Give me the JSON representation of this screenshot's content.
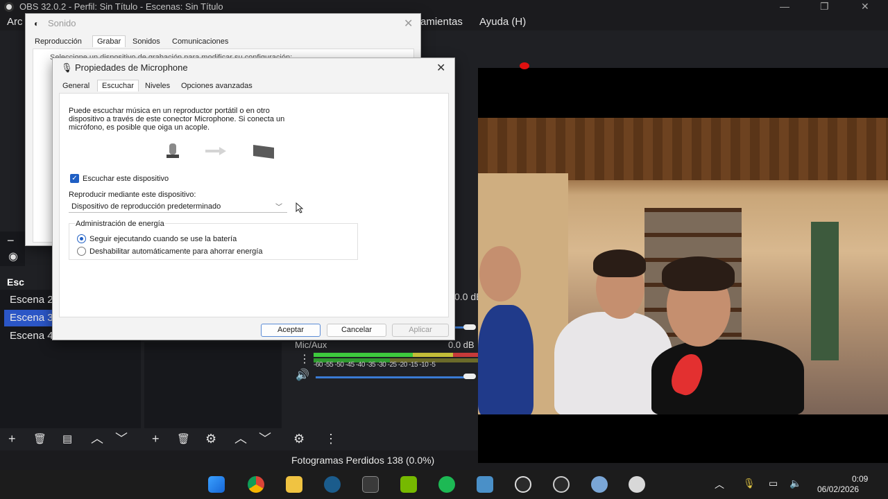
{
  "obs": {
    "title": "OBS 32.0.2 - Perfil: Sin Título - Escenas: Sin Título",
    "menu_visible": [
      "Arc",
      "amientas",
      "Ayuda (H)"
    ],
    "scenes_dock_title": "Esc",
    "scenes": [
      "Escena 2",
      "Escena 3",
      "Escena 4"
    ],
    "selected_scene": "Escena 3",
    "mixer": {
      "track_top_db": "0.0 dB",
      "track_name": "Mic/Aux",
      "track_db": "0.0 dB",
      "scale": "-60 -55 -50 -45 -40 -35 -30 -25 -20 -15 -10 -5"
    },
    "status": "Fotogramas Perdidos 138 (0.0%)"
  },
  "sound_dialog": {
    "title": "Sonido",
    "tabs": [
      "Reproducción",
      "Grabar",
      "Sonidos",
      "Comunicaciones"
    ],
    "active_tab": "Grabar",
    "hint": "Seleccione un dispositivo de grabación para modificar su configuración:"
  },
  "mic_dialog": {
    "title": "Propiedades de Microphone",
    "tabs": [
      "General",
      "Escuchar",
      "Niveles",
      "Opciones avanzadas"
    ],
    "active_tab": "Escuchar",
    "description": [
      "Puede escuchar música en un reproductor portátil o en otro",
      "dispositivo a través de este conector Microphone. Si conecta un",
      "micrófono, es posible que oiga un acople."
    ],
    "listen_checkbox": {
      "label": "Escuchar este dispositivo",
      "checked": true
    },
    "playback_label": "Reproducir mediante este dispositivo:",
    "playback_value": "Dispositivo de reproducción predeterminado",
    "power_group": "Administración de energía",
    "power_options": [
      {
        "label": "Seguir ejecutando cuando se use la batería",
        "selected": true
      },
      {
        "label": "Deshabilitar automáticamente para ahorrar energía",
        "selected": false
      }
    ],
    "buttons": {
      "ok": "Aceptar",
      "cancel": "Cancelar",
      "apply": "Aplicar"
    }
  },
  "taskbar": {
    "time": "0:09",
    "date": "06/02/2026"
  },
  "colors": {
    "accent": "#2b56c6",
    "meter_green": "#3fcf3f",
    "meter_yellow": "#c8c23a",
    "meter_red": "#c83a3a"
  }
}
